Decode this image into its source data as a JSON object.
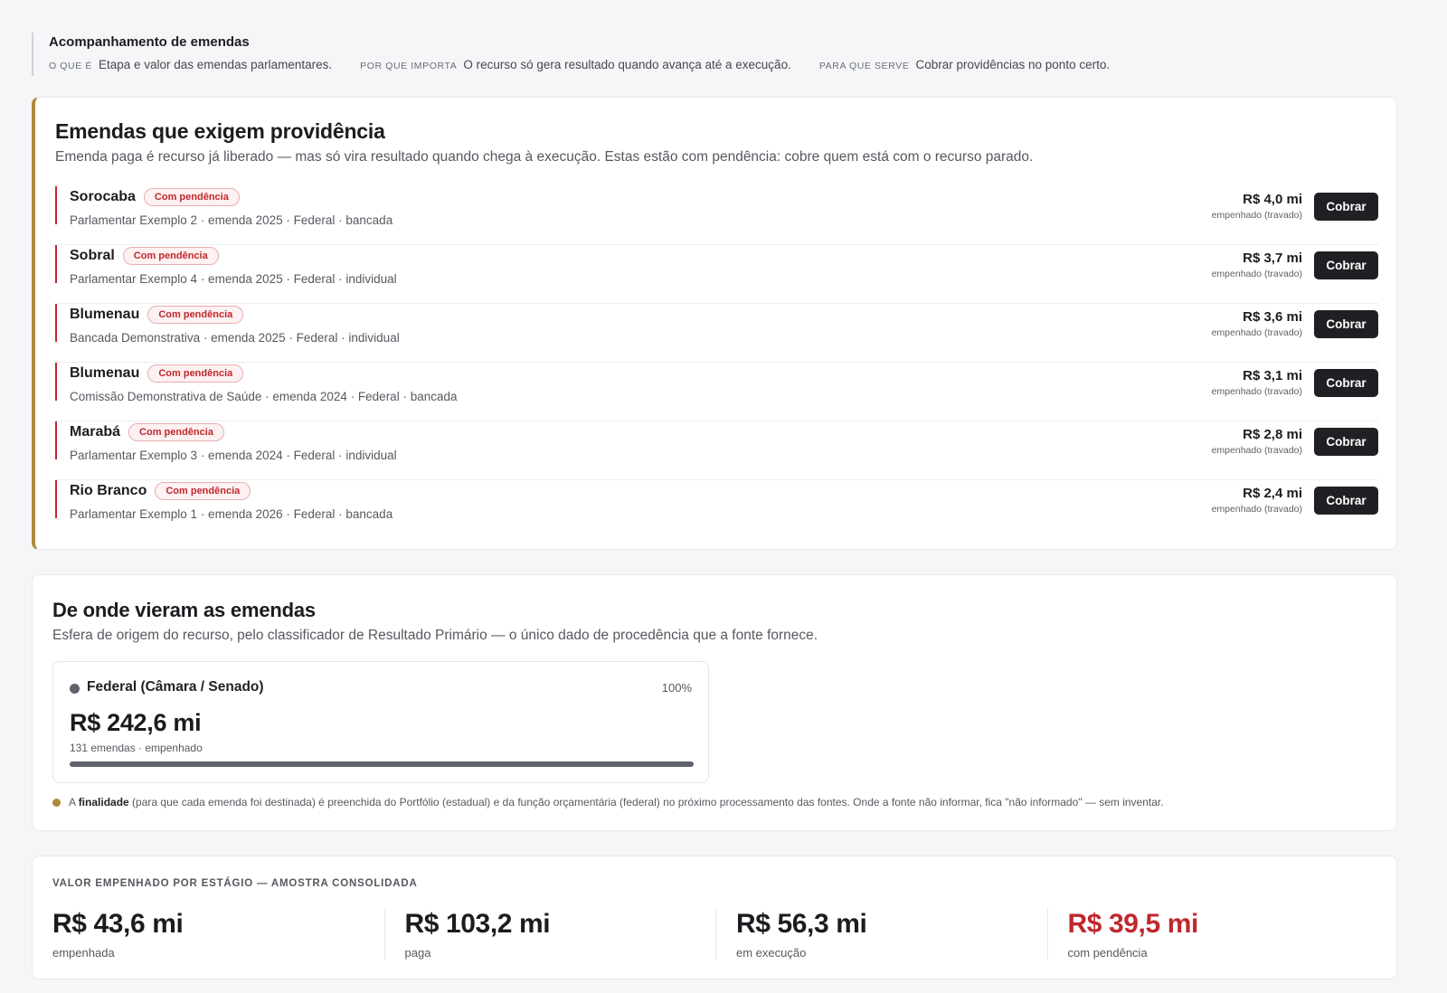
{
  "header": {
    "title": "Acompanhamento de emendas",
    "meta": [
      {
        "key": "O QUE É",
        "text": "Etapa e valor das emendas parlamentares."
      },
      {
        "key": "POR QUE IMPORTA",
        "text": "O recurso só gera resultado quando avança até a execução."
      },
      {
        "key": "PARA QUE SERVE",
        "text": "Cobrar providências no ponto certo."
      }
    ]
  },
  "providencias": {
    "title": "Emendas que exigem providência",
    "subtitle": "Emenda paga é recurso já liberado — mas só vira resultado quando chega à execução. Estas estão com pendência: cobre quem está com o recurso parado.",
    "rows": [
      {
        "city": "Sorocaba",
        "badge": "Com pendência",
        "desc": "Parlamentar Exemplo 2 · emenda 2025 · Federal · bancada",
        "value": "R$ 4,0 mi",
        "value_sub": "empenhado (travado)",
        "action": "Cobrar"
      },
      {
        "city": "Sobral",
        "badge": "Com pendência",
        "desc": "Parlamentar Exemplo 4 · emenda 2025 · Federal · individual",
        "value": "R$ 3,7 mi",
        "value_sub": "empenhado (travado)",
        "action": "Cobrar"
      },
      {
        "city": "Blumenau",
        "badge": "Com pendência",
        "desc": "Bancada Demonstrativa · emenda 2025 · Federal · individual",
        "value": "R$ 3,6 mi",
        "value_sub": "empenhado (travado)",
        "action": "Cobrar"
      },
      {
        "city": "Blumenau",
        "badge": "Com pendência",
        "desc": "Comissão Demonstrativa de Saúde · emenda 2024 · Federal · bancada",
        "value": "R$ 3,1 mi",
        "value_sub": "empenhado (travado)",
        "action": "Cobrar"
      },
      {
        "city": "Marabá",
        "badge": "Com pendência",
        "desc": "Parlamentar Exemplo 3 · emenda 2024 · Federal · individual",
        "value": "R$ 2,8 mi",
        "value_sub": "empenhado (travado)",
        "action": "Cobrar"
      },
      {
        "city": "Rio Branco",
        "badge": "Com pendência",
        "desc": "Parlamentar Exemplo 1 · emenda 2026 · Federal · bancada",
        "value": "R$ 2,4 mi",
        "value_sub": "empenhado (travado)",
        "action": "Cobrar"
      }
    ]
  },
  "origem": {
    "title": "De onde vieram as emendas",
    "subtitle": "Esfera de origem do recurso, pelo classificador de Resultado Primário — o único dado de procedência que a fonte fornece.",
    "source": {
      "label": "Federal (Câmara / Senado)",
      "percent_text": "100%",
      "share": 1.0,
      "amount": "R$ 242,6 mi",
      "count": "131 emendas · empenhado",
      "color": "#5f636b"
    },
    "note": {
      "prefix": "A",
      "bold": "finalidade",
      "rest": "(para que cada emenda foi destinada) é preenchida do Portfólio (estadual) e da função orçamentária (federal) no próximo processamento das fontes. Onde a fonte não informar, fica \"não informado\" — sem inventar.",
      "dot_color": "#b08a3a"
    }
  },
  "estagios": {
    "caption": "VALOR EMPENHADO POR ESTÁGIO — AMOSTRA CONSOLIDADA",
    "items": [
      {
        "value": "R$ 43,6 mi",
        "label": "empenhada"
      },
      {
        "value": "R$ 103,2 mi",
        "label": "paga"
      },
      {
        "value": "R$ 56,3 mi",
        "label": "em execução"
      },
      {
        "value": "R$ 39,5 mi",
        "label": "com pendência"
      }
    ]
  },
  "colors": {
    "accent": "#b08a3a",
    "alert": "#c0272d",
    "button": "#1f2023"
  }
}
